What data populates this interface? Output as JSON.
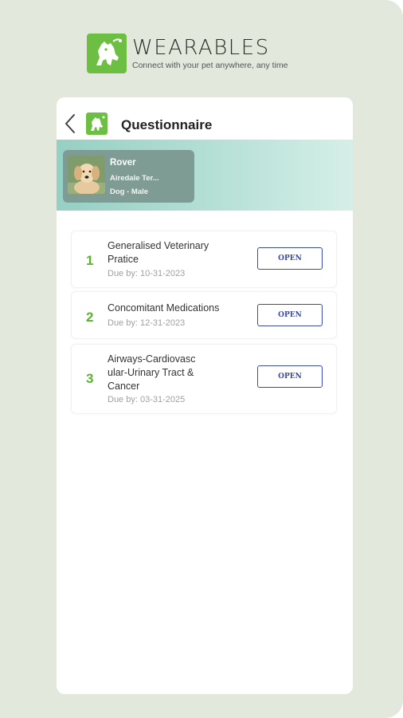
{
  "brand": {
    "name": "WEARABLES",
    "tagline": "Connect with your pet anywhere, any time"
  },
  "header": {
    "title": "Questionnaire"
  },
  "pet": {
    "name": "Rover",
    "breed": "Airedale Ter...",
    "type": "Dog - Male"
  },
  "questionnaires": [
    {
      "number": "1",
      "title": "Generalised Veterinary Pratice",
      "due": "Due by: 10-31-2023",
      "button": "OPEN"
    },
    {
      "number": "2",
      "title": "Concomitant Medications",
      "due": "Due by: 12-31-2023",
      "button": "OPEN"
    },
    {
      "number": "3",
      "title": "Airways-Cardiovasc ular-Urinary Tract & Cancer",
      "due": "Due by: 03-31-2025",
      "button": "OPEN"
    }
  ],
  "colors": {
    "accent_green": "#58b52e",
    "logo_green": "#6cbf43",
    "button_blue": "#3b4aa8",
    "banner_teal": "#96cfc4",
    "background": "#e2e9dc"
  },
  "icons": {
    "brand": "dog-logo-icon",
    "back": "chevron-left-icon"
  }
}
